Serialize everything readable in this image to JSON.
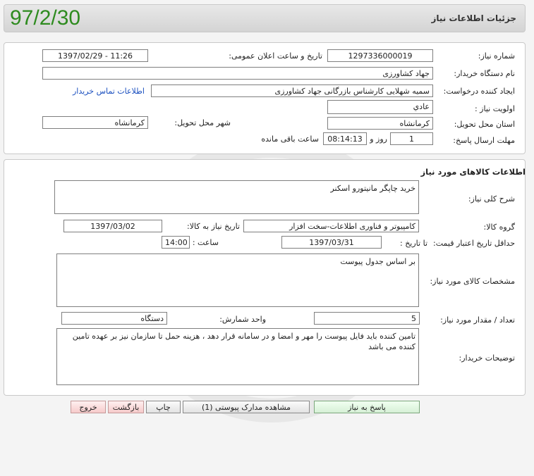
{
  "header": {
    "title": "جزئیات اطلاعات نیاز",
    "date": "97/2/30"
  },
  "info": {
    "need_number_label": "شماره نیاز:",
    "need_number": "1297336000019",
    "announce_label": "تاریخ و ساعت اعلان عمومی:",
    "announce_value": "1397/02/29 - 11:26",
    "buyer_org_label": "نام دستگاه خریدار:",
    "buyer_org": "جهاد کشاورزی",
    "creator_label": "ایجاد کننده درخواست:",
    "creator": "سمیه شهلایی کارشناس بازرگانی جهاد کشاورزی",
    "contact_link": "اطلاعات تماس خریدار",
    "priority_label": "اولویت نیاز :",
    "priority": "عادي",
    "province_label": "استان محل تحویل:",
    "province": "کرمانشاه",
    "city_label": "شهر محل تحویل:",
    "city": "کرمانشاه",
    "deadline_label": "مهلت ارسال پاسخ:",
    "deadline_days": "1",
    "day_word": "روز و",
    "deadline_time": "08:14:13",
    "remaining_label": "ساعت باقی مانده"
  },
  "goods": {
    "section_title": "اطلاعات کالاهای مورد نیاز",
    "summary_label": "شرح کلی نیاز:",
    "summary": "خرید چاپگر مانیتورو اسکنر",
    "group_label": "گروه کالا:",
    "group": "کامپیوتر و فناوری اطلاعات-سخت افزار",
    "need_date_label": "تاریخ نیاز به کالا:",
    "need_date": "1397/03/02",
    "validity_label": "حداقل تاریخ اعتبار قیمت:",
    "to_date_label": "تا تاریخ :",
    "to_date": "1397/03/31",
    "time_label": "ساعت :",
    "time": "14:00",
    "specs_label": "مشخصات کالای مورد نیاز:",
    "specs": "بر اساس جدول پیوست",
    "qty_label": "تعداد / مقدار مورد نیاز:",
    "qty": "5",
    "unit_label": "واحد شمارش:",
    "unit": "دستگاه",
    "buyer_notes_label": "توضیحات خریدار:",
    "buyer_notes": "تامین کننده باید فایل پیوست را مهر و امضا و در سامانه قرار دهد ، هزینه حمل تا سازمان نیز بر عهده تامین کننده می باشد"
  },
  "buttons": {
    "reply": "پاسخ به نیاز",
    "attachments": "مشاهده مدارک پیوستی (1)",
    "print": "چاپ",
    "back": "بازگشت",
    "exit": "خروج"
  },
  "watermark": {
    "text1": "هزاره",
    "text2": "گستران",
    "text3": "تبلیغ"
  }
}
